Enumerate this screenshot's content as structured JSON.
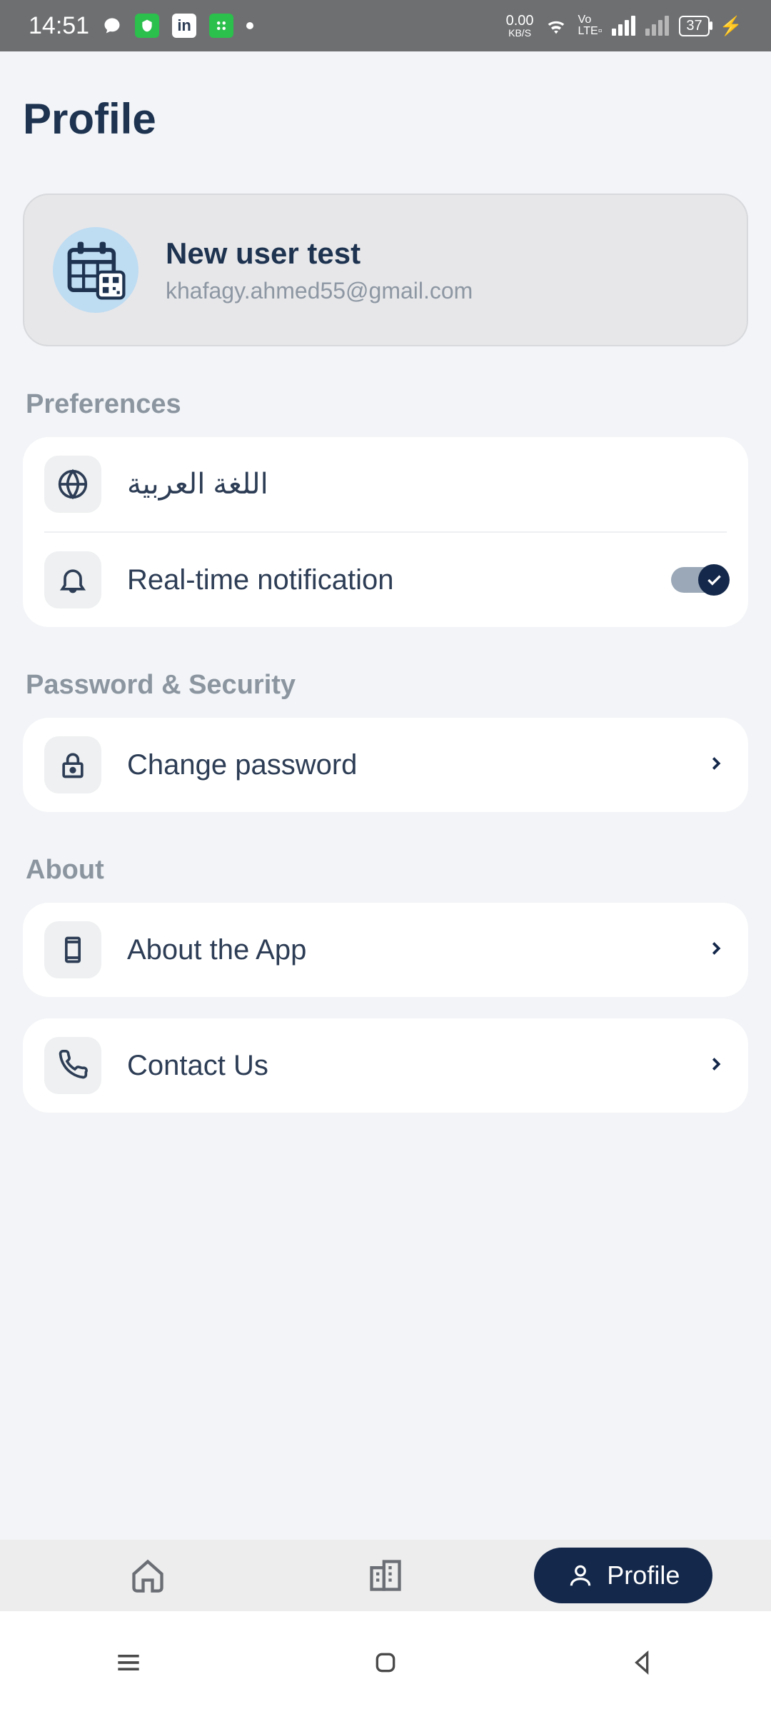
{
  "status": {
    "time": "14:51",
    "kbs_value": "0.00",
    "kbs_label": "KB/S",
    "volte": "Vo LTE2",
    "battery": "37"
  },
  "page": {
    "title": "Profile"
  },
  "user": {
    "name": "New user test",
    "email": "khafagy.ahmed55@gmail.com"
  },
  "sections": {
    "preferences": {
      "title": "Preferences",
      "language_label": "اللغة العربية",
      "notifications_label": "Real-time notification",
      "notifications_on": true
    },
    "security": {
      "title": "Password & Security",
      "change_password_label": "Change password"
    },
    "about": {
      "title": "About",
      "about_app_label": "About the App",
      "contact_label": "Contact Us"
    }
  },
  "nav": {
    "profile_label": "Profile"
  },
  "colors": {
    "primary_dark": "#14284b",
    "text_dark": "#1e3350",
    "muted": "#8b95a0"
  }
}
